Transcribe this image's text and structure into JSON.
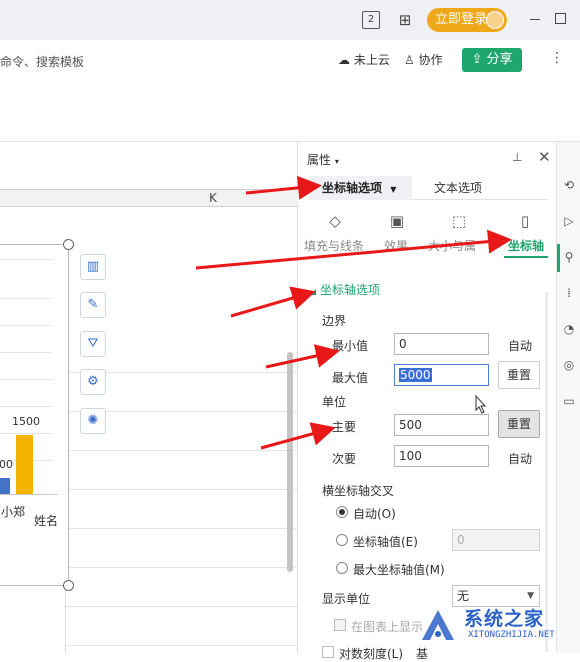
{
  "titlebar": {
    "sheet_icon_label": "2",
    "login_label": "立即登录"
  },
  "ribbon": {
    "search_hint": "命令、搜索模板",
    "cloud_label": "未上云",
    "collab_label": "协作",
    "share_label": "分享"
  },
  "sheet": {
    "column_k": "K",
    "data_label": "1500",
    "partial_value": "00",
    "category_label": "小郑",
    "axis_title": "姓名"
  },
  "panel": {
    "title": "属性",
    "tabs": [
      "坐标轴选项",
      "文本选项"
    ],
    "categories": [
      "填充与线条",
      "效果",
      "大小与属",
      "坐标轴"
    ],
    "section_title": "坐标轴选项",
    "bounds": {
      "heading": "边界",
      "min_label": "最小值",
      "min_value": "0",
      "min_status": "自动",
      "max_label": "最大值",
      "max_value": "5000",
      "max_reset": "重置"
    },
    "units": {
      "heading": "单位",
      "major_label": "主要",
      "major_value": "500",
      "major_reset": "重置",
      "minor_label": "次要",
      "minor_value": "100",
      "minor_status": "自动"
    },
    "cross": {
      "heading": "横坐标轴交叉",
      "opt_auto": "自动(O)",
      "opt_axis_value": "坐标轴值(E)",
      "axis_value": "0",
      "opt_max": "最大坐标轴值(M)"
    },
    "display_unit": {
      "label": "显示单位",
      "value": "无",
      "show_on_chart": "在图表上显示"
    },
    "log_scale_label": "对数刻度(L)",
    "log_base_label": "基"
  },
  "watermark": {
    "main": "系统之家",
    "sub": "XITONGZHIJIA.NET"
  },
  "colors": {
    "accent_green": "#1fa56e",
    "login_orange": "#f0a81b",
    "bar_blue": "#4472c4",
    "bar_orange": "#f4b400",
    "arrow_red": "#e81818",
    "selection_blue": "#3b6fd8"
  }
}
